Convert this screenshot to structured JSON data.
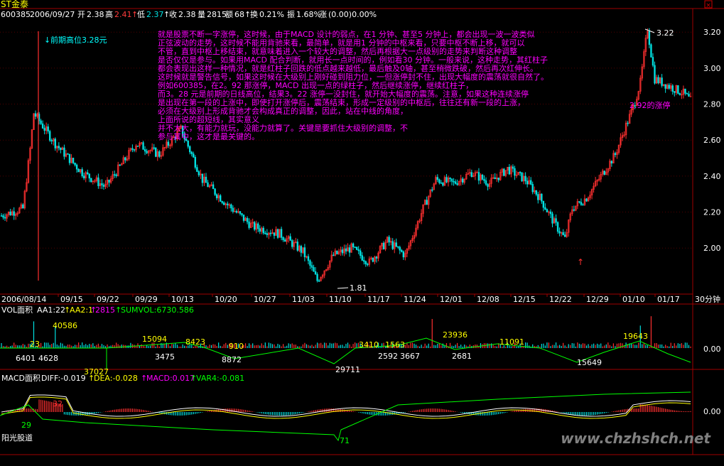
{
  "header": {
    "name": "ST金泰",
    "code": "600385",
    "date": "2006/09/27",
    "open_label": "开",
    "open": "2.38",
    "high_label": "高",
    "high": "2.41",
    "low_label": "低",
    "low": "2.37",
    "close_label": "收",
    "close": "2.38",
    "vol_label": "量",
    "vol": "2815",
    "amt_label": "额",
    "amt": "68",
    "turn_label": "换",
    "turn": "0.21%",
    "amp_label": "振",
    "amp": "1.68%",
    "chg_label": "涨",
    "chg": "(0.00)0.00%"
  },
  "annotations": {
    "prev_high": "前期高位3.28元",
    "peak": "3.22",
    "limit": "2.92的涨停",
    "low": "1.81",
    "note_lines": [
      "就是股票不断一字涨停，这时候，由于MACD 设计的弱点，在1 分钟、甚至5 分钟上，都会出现一波一波类似",
      "正弦波动的走势，这时候不能用背驰来看，最简单，就是用1 分钟的中枢来看，只要中枢不断上移，就可以",
      "不管，直到中枢上移结束，就意味着进入一个较大的调整，然后再根据大一点级别的走势来判断这种调整",
      "是否仅仅是参与。如果用MACD 配合判断，就用长一点时间的，例如看30 分钟。一般来说，这种走势，其红柱子",
      "都会表现出这样一种情况，就是红柱子回跌的低点越来越低，最后触及0轴，甚至稍微跌破，然后再次红伸长。",
      "这时候就是警告信号，如果这时候在大级别上刚好碰到阻力位，一但涨停封不住，出现大幅度的震荡就很自然了。",
      "例如600385，在2。92 那涨停，MACD 出现一点的绿柱子，然后继续涨停，继续红柱子，",
      "而3。28 元是前期的日线高位，结果3。22 涨停一没封住，就开始大幅度的震荡。注意，如果这种连续涨停",
      "是出现在第一段的上涨中，即使打开涨停后，震荡结束，形成一定级别的中枢后，往往还有新一段的上涨，",
      "必须在大级别上形成背驰才会构成真正的调整，因此，站在中线的角度，",
      "上面所说的超短线，其实意义",
      "并不太大，有能力就玩，没能力就算了。关键是要抓住大级别的调整，不",
      "参与其中，这才是最关键的。"
    ]
  },
  "chart_data": [
    {
      "type": "candlestick",
      "x_ticks": [
        "2006/08/14",
        "09/15",
        "09/22",
        "09/29",
        "10/13",
        "10/20",
        "10/27",
        "11/03",
        "11/10",
        "11/17",
        "11/24",
        "12/01",
        "12/08",
        "12/15",
        "12/22",
        "12/29",
        "01/10",
        "01/17"
      ],
      "period": "30分钟",
      "y_ticks": [
        "3.20",
        "3.00",
        "2.80",
        "2.60",
        "2.40",
        "2.20",
        "2.00"
      ],
      "ylim": [
        1.76,
        3.26
      ],
      "anchor_points": [
        {
          "i": 0,
          "v": 2.18
        },
        {
          "i": 12,
          "v": 2.22
        },
        {
          "i": 16,
          "v": 2.55
        },
        {
          "i": 18,
          "v": 2.75
        },
        {
          "i": 30,
          "v": 2.58
        },
        {
          "i": 45,
          "v": 2.42
        },
        {
          "i": 58,
          "v": 2.34
        },
        {
          "i": 68,
          "v": 2.48
        },
        {
          "i": 75,
          "v": 2.58
        },
        {
          "i": 88,
          "v": 2.52
        },
        {
          "i": 100,
          "v": 2.66
        },
        {
          "i": 112,
          "v": 2.38
        },
        {
          "i": 125,
          "v": 2.25
        },
        {
          "i": 140,
          "v": 2.12
        },
        {
          "i": 155,
          "v": 2.08
        },
        {
          "i": 168,
          "v": 1.98
        },
        {
          "i": 176,
          "v": 1.82
        },
        {
          "i": 185,
          "v": 1.96
        },
        {
          "i": 195,
          "v": 2.0
        },
        {
          "i": 205,
          "v": 1.92
        },
        {
          "i": 215,
          "v": 2.04
        },
        {
          "i": 225,
          "v": 1.96
        },
        {
          "i": 235,
          "v": 2.22
        },
        {
          "i": 242,
          "v": 2.38
        },
        {
          "i": 252,
          "v": 2.36
        },
        {
          "i": 262,
          "v": 2.42
        },
        {
          "i": 272,
          "v": 2.36
        },
        {
          "i": 282,
          "v": 2.44
        },
        {
          "i": 292,
          "v": 2.38
        },
        {
          "i": 300,
          "v": 2.28
        },
        {
          "i": 308,
          "v": 2.14
        },
        {
          "i": 314,
          "v": 2.05
        },
        {
          "i": 318,
          "v": 2.22
        },
        {
          "i": 326,
          "v": 2.28
        },
        {
          "i": 334,
          "v": 2.4
        },
        {
          "i": 342,
          "v": 2.52
        },
        {
          "i": 348,
          "v": 2.68
        },
        {
          "i": 352,
          "v": 2.78
        },
        {
          "i": 356,
          "v": 2.92
        },
        {
          "i": 360,
          "v": 3.22
        },
        {
          "i": 364,
          "v": 2.94
        },
        {
          "i": 372,
          "v": 2.9
        },
        {
          "i": 380,
          "v": 2.86
        },
        {
          "i": 384,
          "v": 2.82
        }
      ]
    },
    {
      "type": "bar",
      "label_name": "VOL面积",
      "label_aa1": "AA1:22",
      "label_aa2": "AA2:1",
      "label_vol": "2815",
      "label_sum": "SUMVOL:6730.586",
      "y_tick": "0.00",
      "value_labels": [
        {
          "text": "40586",
          "i": 30
        },
        {
          "text": "6401",
          "i": 9
        },
        {
          "text": "23",
          "i": 18
        },
        {
          "text": "4628",
          "i": 23
        },
        {
          "text": "15094",
          "i": 80
        },
        {
          "text": "3475",
          "i": 86
        },
        {
          "text": "37027",
          "i": 58
        },
        {
          "text": "8423",
          "i": 104
        },
        {
          "text": "8872",
          "i": 126
        },
        {
          "text": "910",
          "i": 128
        },
        {
          "text": "3410",
          "i": 200
        },
        {
          "text": "1563",
          "i": 215
        },
        {
          "text": "2592",
          "i": 212
        },
        {
          "text": "3667",
          "i": 226
        },
        {
          "text": "23936",
          "i": 250
        },
        {
          "text": "2681",
          "i": 254
        },
        {
          "text": "29711",
          "i": 186
        },
        {
          "text": "11091",
          "i": 282
        },
        {
          "text": "15649",
          "i": 324
        },
        {
          "text": "19643",
          "i": 358
        }
      ]
    },
    {
      "type": "bar",
      "label_name": "MACD面积",
      "label_diff": "DIFF:-0.019",
      "label_dea": "DEA:-0.028",
      "label_macd": "MACD:0.017",
      "label_var4": "VAR4:-0.081",
      "y_tick": "0.00",
      "value_labels": [
        {
          "text": "32",
          "i": 30
        },
        {
          "text": "29",
          "i": 12
        },
        {
          "text": "71",
          "i": 190
        }
      ],
      "footer": "阳光股道",
      "watermark": "www.chzhshch.net"
    }
  ]
}
